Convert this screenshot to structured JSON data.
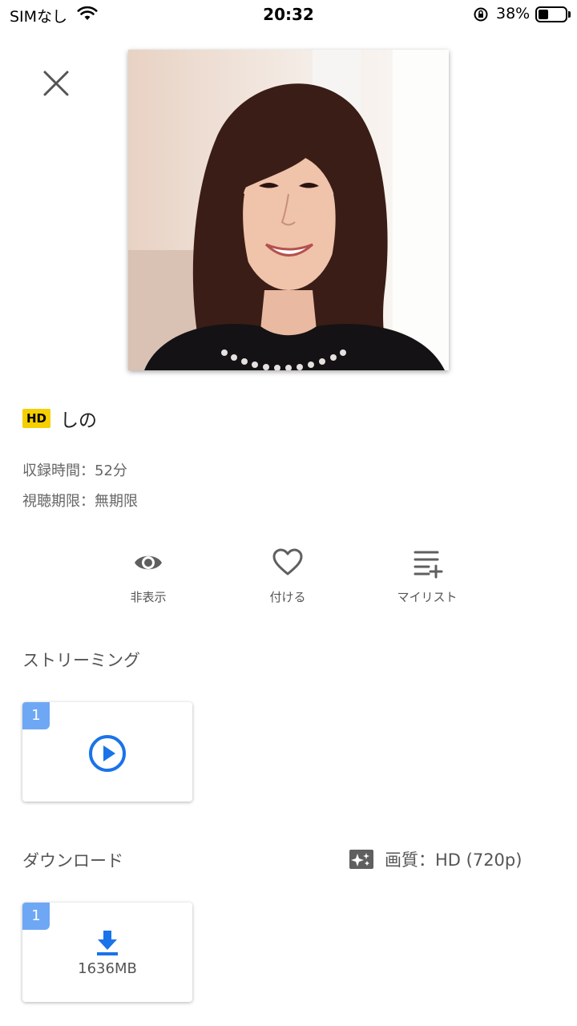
{
  "status_bar": {
    "carrier": "SIMなし",
    "time": "20:32",
    "battery_percent_text": "38%",
    "battery_level": 0.38
  },
  "video": {
    "badge": "HD",
    "title": "しの",
    "duration": "収録時間：52分",
    "expiry": "視聴期限：無期限"
  },
  "actions": [
    {
      "label": "非表示",
      "icon": "eye-icon"
    },
    {
      "label": "付ける",
      "icon": "heart-icon"
    },
    {
      "label": "マイリスト",
      "icon": "playlist-add-icon"
    }
  ],
  "streaming": {
    "title": "ストリーミング",
    "items": [
      {
        "number": "1",
        "icon": "play-circle-icon"
      }
    ]
  },
  "download": {
    "title": "ダウンロード",
    "quality": "画質：HD (720p)",
    "items": [
      {
        "number": "1",
        "size": "1636MB",
        "icon": "download-icon"
      }
    ]
  },
  "colors": {
    "accent_blue": "#1a73e8",
    "badge_yellow": "#f5cf00",
    "card_number_blue": "#6ea8f5"
  }
}
